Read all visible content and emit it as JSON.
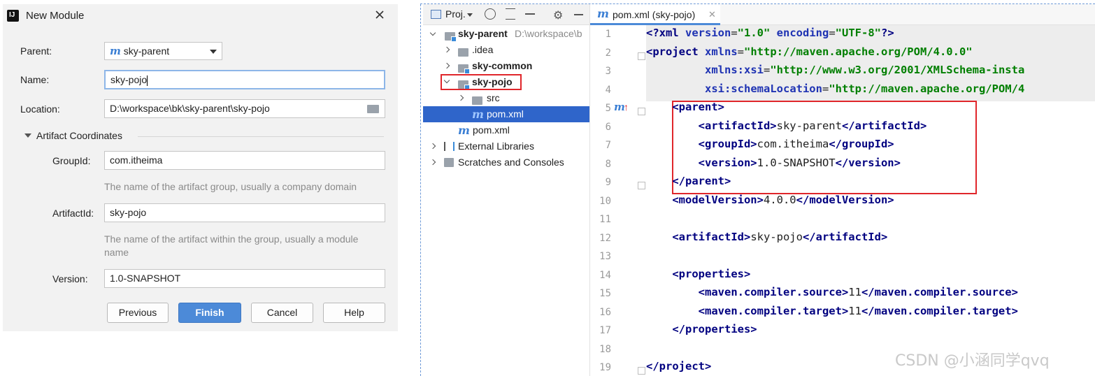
{
  "dialog": {
    "title": "New Module",
    "parent_label": "Parent:",
    "parent_value": "sky-parent",
    "name_label": "Name:",
    "name_value": "sky-pojo",
    "location_label": "Location:",
    "location_value": "D:\\workspace\\bk\\sky-parent\\sky-pojo",
    "artifact_section": "Artifact Coordinates",
    "groupid_label": "GroupId:",
    "groupid_value": "com.itheima",
    "groupid_hint": "The name of the artifact group, usually a company domain",
    "artifactid_label": "ArtifactId:",
    "artifactid_value": "sky-pojo",
    "artifactid_hint": "The name of the artifact within the group, usually a module name",
    "version_label": "Version:",
    "version_value": "1.0-SNAPSHOT",
    "buttons": {
      "previous": "Previous",
      "finish": "Finish",
      "cancel": "Cancel",
      "help": "Help"
    }
  },
  "project": {
    "toolbar_title": "Proj.",
    "root": {
      "name": "sky-parent",
      "path": "D:\\workspace\\b"
    },
    "items": [
      ".idea",
      "sky-common",
      "sky-pojo",
      "src",
      "pom.xml",
      "pom.xml",
      "External Libraries",
      "Scratches and Consoles"
    ]
  },
  "editor": {
    "tab_label": "pom.xml (sky-pojo)",
    "line_numbers": [
      "1",
      "2",
      "3",
      "4",
      "5",
      "6",
      "7",
      "8",
      "9",
      "10",
      "11",
      "12",
      "13",
      "14",
      "15",
      "16",
      "17",
      "18",
      "19"
    ]
  },
  "watermark": "CSDN @小涵同学qvq",
  "colors": {
    "accent": "#4c8ad8",
    "selection": "#2f65ca",
    "highlight_box": "#e0262b",
    "tag": "#000080",
    "string": "#007f00"
  }
}
